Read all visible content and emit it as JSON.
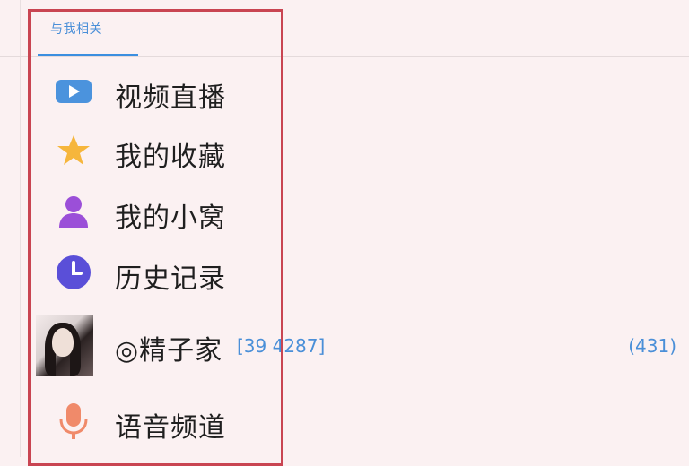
{
  "tab": {
    "label": "与我相关"
  },
  "menu": {
    "items": [
      {
        "label": "视频直播",
        "icon": "video-camera-icon",
        "color": "#4b93dd"
      },
      {
        "label": "我的收藏",
        "icon": "star-icon",
        "color": "#f6b63c"
      },
      {
        "label": "我的小窝",
        "icon": "person-icon",
        "color": "#9b4fd8"
      },
      {
        "label": "历史记录",
        "icon": "clock-icon",
        "color": "#5a4fd8"
      },
      {
        "label": "◎精子家",
        "meta": "[39 4287]",
        "count": "(431)",
        "icon": "avatar"
      },
      {
        "label": "语音频道",
        "icon": "microphone-icon",
        "color": "#f08a6a"
      }
    ]
  },
  "colors": {
    "background": "#fbf1f2",
    "accent": "#3b8fe0",
    "highlight": "#c94552"
  }
}
